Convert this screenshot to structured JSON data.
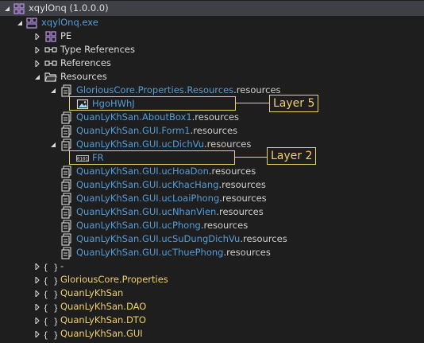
{
  "root": {
    "label": "xqylOnq",
    "version": "(1.0.0.0)"
  },
  "module": {
    "label": "xqylOnq.exe"
  },
  "nodes": {
    "pe": "PE",
    "type_references": "Type References",
    "references": "References",
    "resources": "Resources"
  },
  "resource_files": [
    {
      "name": "GloriousCore.Properties.Resources",
      "suffix": ".resources"
    },
    {
      "name": "QuanLyKhSan.AboutBox1",
      "suffix": ".resources"
    },
    {
      "name": "QuanLyKhSan.GUI.Form1",
      "suffix": ".resources"
    },
    {
      "name": "QuanLyKhSan.GUI.ucDichVu",
      "suffix": ".resources"
    },
    {
      "name": "QuanLyKhSan.GUI.ucHoaDon",
      "suffix": ".resources"
    },
    {
      "name": "QuanLyKhSan.GUI.ucKhacHang",
      "suffix": ".resources"
    },
    {
      "name": "QuanLyKhSan.GUI.ucLoaiPhong",
      "suffix": ".resources"
    },
    {
      "name": "QuanLyKhSan.GUI.ucNhanVien",
      "suffix": ".resources"
    },
    {
      "name": "QuanLyKhSan.GUI.ucPhong",
      "suffix": ".resources"
    },
    {
      "name": "QuanLyKhSan.GUI.ucSuDungDichVu",
      "suffix": ".resources"
    },
    {
      "name": "QuanLyKhSan.GUI.ucThuePhong",
      "suffix": ".resources"
    }
  ],
  "resource_entries": {
    "image_entry": "HgoHWhJ",
    "binary_entry": "FR"
  },
  "namespaces": [
    "-",
    "GloriousCore.Properties",
    "QuanLyKhSan",
    "QuanLyKhSan.DAO",
    "QuanLyKhSan.DTO",
    "QuanLyKhSan.GUI"
  ],
  "annotations": {
    "layer5": "Layer 5",
    "layer2": "Layer 2"
  },
  "colors": {
    "background": "#1e1e1e",
    "selection": "#3f3f46",
    "link_blue": "#569cd6",
    "namespace_yellow": "#f0d070",
    "annotation": "#e6d36a"
  }
}
